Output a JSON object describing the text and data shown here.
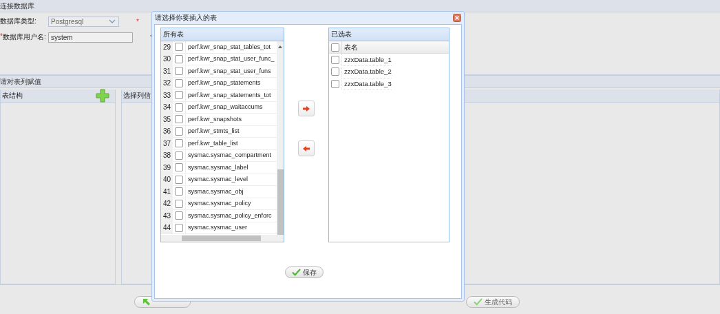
{
  "connection_panel": {
    "title": "连接数据库",
    "fields": [
      {
        "label": "数据库类型:",
        "required": false,
        "kind": "select",
        "value": "Postgresql"
      },
      {
        "label": "数据库用户名:",
        "required": true,
        "kind": "text",
        "value": "system"
      }
    ],
    "hidden_markers": [
      "*",
      "*"
    ]
  },
  "assign_panel": {
    "title": "请对表列赋值",
    "structure": {
      "title": "表结构"
    },
    "columns": {
      "title": "选择列信"
    }
  },
  "bottom_buttons": [
    {
      "kind": "back"
    },
    {
      "label": "生成代码",
      "kind": "generate"
    }
  ],
  "dialog": {
    "title": "请选择你要插入的表",
    "all_tables": {
      "title": "所有表",
      "rows": [
        {
          "number": "29",
          "checked": false,
          "name": "perf.kwr_snap_stat_tables_tot"
        },
        {
          "number": "30",
          "checked": false,
          "name": "perf.kwr_snap_stat_user_func_"
        },
        {
          "number": "31",
          "checked": false,
          "name": "perf.kwr_snap_stat_user_funs"
        },
        {
          "number": "32",
          "checked": false,
          "name": "perf.kwr_snap_statements"
        },
        {
          "number": "33",
          "checked": false,
          "name": "perf.kwr_snap_statements_tot"
        },
        {
          "number": "34",
          "checked": false,
          "name": "perf.kwr_snap_waitaccums"
        },
        {
          "number": "35",
          "checked": false,
          "name": "perf.kwr_snapshots"
        },
        {
          "number": "36",
          "checked": false,
          "name": "perf.kwr_stmts_list"
        },
        {
          "number": "37",
          "checked": false,
          "name": "perf.kwr_table_list"
        },
        {
          "number": "38",
          "checked": false,
          "name": "sysmac.sysmac_compartment"
        },
        {
          "number": "39",
          "checked": false,
          "name": "sysmac.sysmac_label"
        },
        {
          "number": "40",
          "checked": false,
          "name": "sysmac.sysmac_level"
        },
        {
          "number": "41",
          "checked": false,
          "name": "sysmac.sysmac_obj"
        },
        {
          "number": "42",
          "checked": false,
          "name": "sysmac.sysmac_policy"
        },
        {
          "number": "43",
          "checked": false,
          "name": "sysmac.sysmac_policy_enforc"
        },
        {
          "number": "44",
          "checked": false,
          "name": "sysmac.sysmac_user"
        }
      ]
    },
    "selected_tables": {
      "title": "已选表",
      "header_checked": false,
      "column": "表名",
      "rows": [
        {
          "checked": false,
          "name": "zzxData.table_1"
        },
        {
          "checked": false,
          "name": "zzxData.table_2"
        },
        {
          "checked": false,
          "name": "zzxData.table_3"
        }
      ]
    },
    "save_button": "保存"
  }
}
